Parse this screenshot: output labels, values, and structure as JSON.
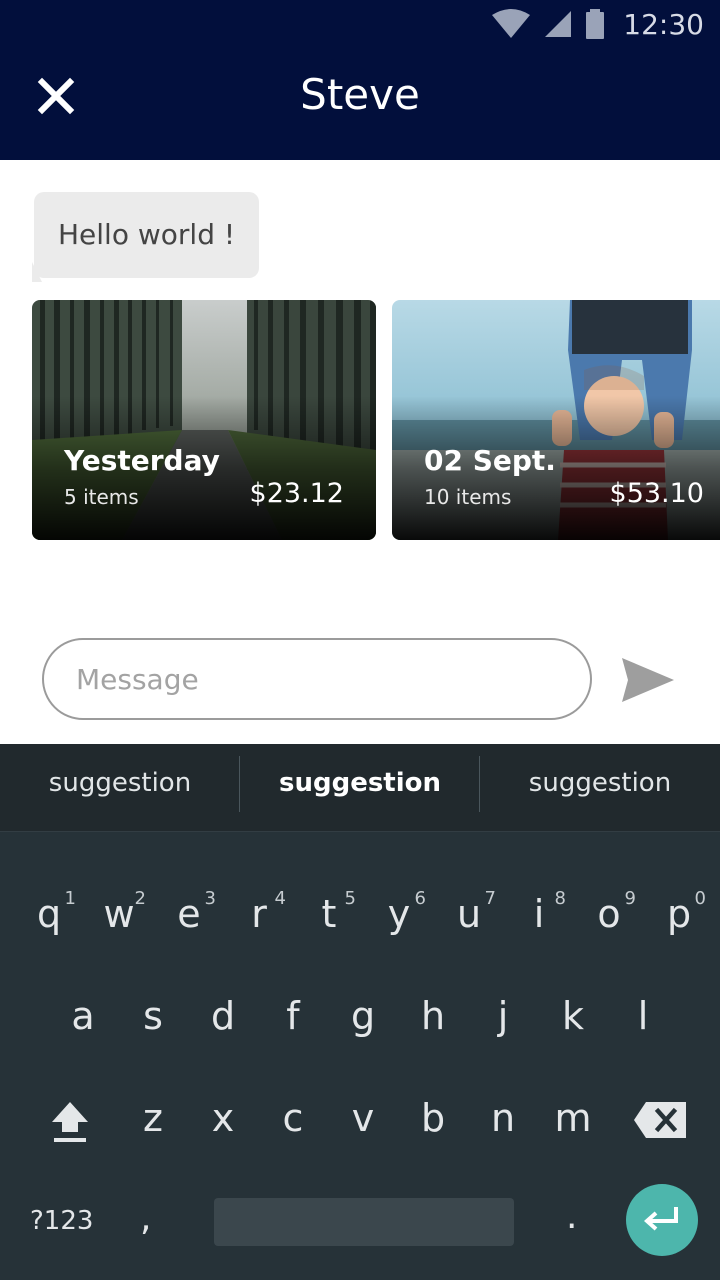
{
  "status_bar": {
    "time": "12:30"
  },
  "header": {
    "title": "Steve",
    "close_icon": "close-icon"
  },
  "chat": {
    "message": "Hello world !"
  },
  "cards": [
    {
      "title": "Yesterday",
      "items": "5 items",
      "price": "$23.12"
    },
    {
      "title": "02 Sept.",
      "items": "10 items",
      "price": "$53.10"
    }
  ],
  "composer": {
    "placeholder": "Message",
    "send_icon": "send-icon"
  },
  "keyboard": {
    "suggestions": [
      "suggestion",
      "suggestion",
      "suggestion"
    ],
    "row1": [
      {
        "k": "q",
        "n": "1"
      },
      {
        "k": "w",
        "n": "2"
      },
      {
        "k": "e",
        "n": "3"
      },
      {
        "k": "r",
        "n": "4"
      },
      {
        "k": "t",
        "n": "5"
      },
      {
        "k": "y",
        "n": "6"
      },
      {
        "k": "u",
        "n": "7"
      },
      {
        "k": "i",
        "n": "8"
      },
      {
        "k": "o",
        "n": "9"
      },
      {
        "k": "p",
        "n": "0"
      }
    ],
    "row2": [
      "a",
      "s",
      "d",
      "f",
      "g",
      "h",
      "j",
      "k",
      "l"
    ],
    "row3": [
      "z",
      "x",
      "c",
      "v",
      "b",
      "n",
      "m"
    ],
    "symbols": "?123",
    "comma": ",",
    "period": ".",
    "accent_color": "#4db6ac"
  },
  "colors": {
    "app_bar": "#020f3c",
    "keyboard_bg": "#263238"
  }
}
